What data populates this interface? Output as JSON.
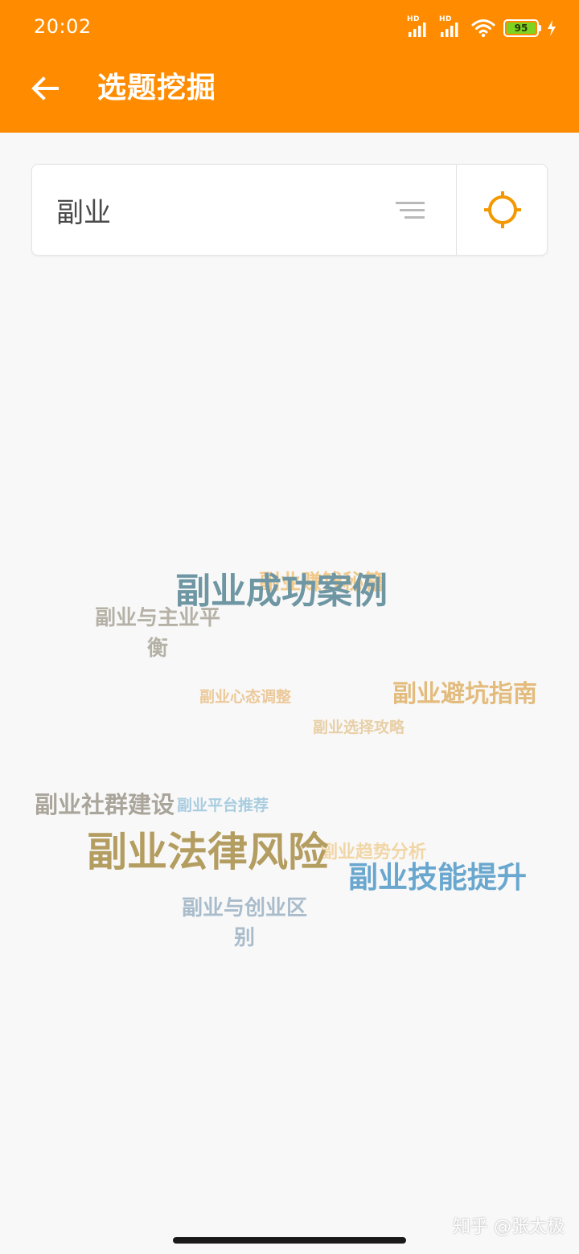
{
  "status_bar": {
    "time": "20:02",
    "sim1_label": "HD",
    "sim2_label": "HD",
    "battery": "95",
    "icons": [
      "signal-icon",
      "signal-icon",
      "wifi-icon",
      "battery-icon",
      "charging-icon"
    ]
  },
  "header": {
    "title": "选题挖掘",
    "back_icon": "arrow-left-icon",
    "background_color": "#ff8c00"
  },
  "search": {
    "value": "副业",
    "filter_icon": "filter-lines-icon",
    "target_icon": "crosshair-icon",
    "accent_color": "#f39800"
  },
  "word_cloud": {
    "words": [
      {
        "text": "副业成功案例",
        "color": "#6f96a3"
      },
      {
        "text": "副业赚钱秘籍",
        "color": "#f0c98b"
      },
      {
        "text": "副业与主业平衡",
        "color": "#b5b1a6"
      },
      {
        "text": "副业心态调整",
        "color": "#ecc99a"
      },
      {
        "text": "副业避坑指南",
        "color": "#e3bc7d"
      },
      {
        "text": "副业选择攻略",
        "color": "#e8cfa6"
      },
      {
        "text": "副业社群建设",
        "color": "#aaa59b"
      },
      {
        "text": "副业平台推荐",
        "color": "#a9cde0"
      },
      {
        "text": "副业法律风险",
        "color": "#b49d60"
      },
      {
        "text": "副业趋势分析",
        "color": "#f1d6a6"
      },
      {
        "text": "副业技能提升",
        "color": "#69a7cf"
      },
      {
        "text": "副业与创业区别",
        "color": "#a9bccb"
      }
    ]
  },
  "watermark": "知乎 @张太极"
}
